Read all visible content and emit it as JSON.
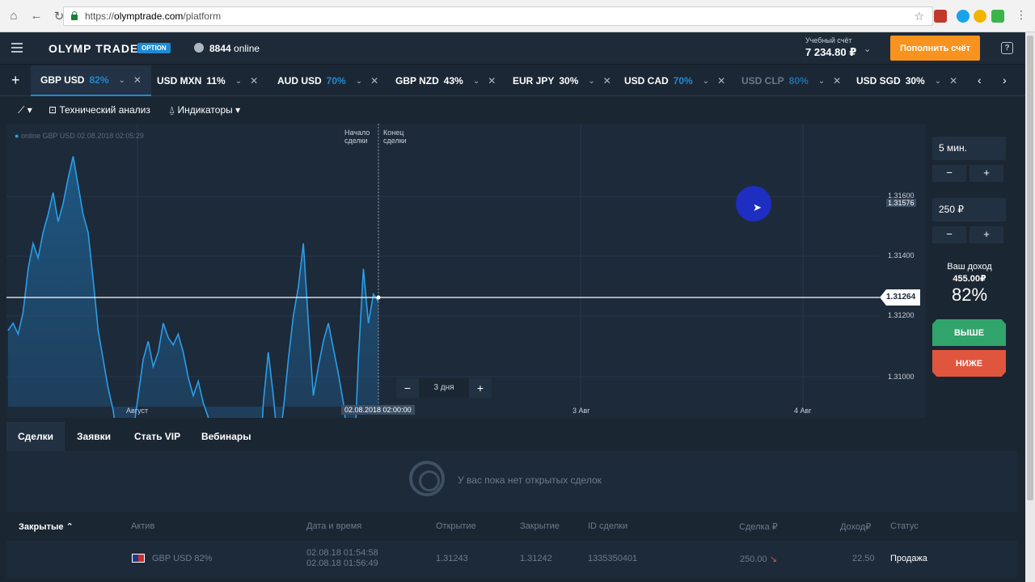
{
  "browser": {
    "url_scheme": "https://",
    "url_host": "olymptrade.com",
    "url_path": "/platform"
  },
  "header": {
    "logo": "OLYMP TRADE",
    "badge": "OPTION",
    "online_count": "8844",
    "online_label": "online",
    "account_label": "Учебный счёт",
    "account_value": "7 234.80 ₽",
    "deposit_label": "Пополнить счёт",
    "help": "?"
  },
  "tabs": [
    {
      "asset": "GBP USD",
      "pct": "82%"
    },
    {
      "asset": "USD MXN",
      "pct": "11%"
    },
    {
      "asset": "AUD USD",
      "pct": "70%"
    },
    {
      "asset": "GBP NZD",
      "pct": "43%"
    },
    {
      "asset": "EUR JPY",
      "pct": "30%"
    },
    {
      "asset": "USD CAD",
      "pct": "70%"
    },
    {
      "asset": "USD CLP",
      "pct": "80%"
    },
    {
      "asset": "USD SGD",
      "pct": "30%"
    }
  ],
  "toolbar": {
    "tech_analysis": "Технический анализ",
    "indicators": "Индикаторы"
  },
  "chart": {
    "legend": "online GBP USD  02.08.2018 02:05:29",
    "deal_start": [
      "Начало",
      "сделки"
    ],
    "deal_end": [
      "Конец",
      "сделки"
    ],
    "current_price": "1.31264",
    "marker_price": "1.31576",
    "y_ticks": [
      "1.31600",
      "1.31400",
      "1.31200",
      "1.31000"
    ],
    "x_labels": [
      "Август",
      "02.08.2018 02:00:00",
      "3 Авг",
      "4 Авг"
    ],
    "zoom_label": "3 дня",
    "zoom_minus": "−",
    "zoom_plus": "+"
  },
  "chart_data": {
    "type": "area",
    "title": "",
    "series": [
      {
        "values": [
          1.3118,
          1.312,
          1.3117,
          1.3123,
          1.3135,
          1.3142,
          1.3138,
          1.3145,
          1.315,
          1.3156,
          1.3148,
          1.3153,
          1.316,
          1.3166,
          1.3158,
          1.315,
          1.3145,
          1.3132,
          1.3118,
          1.311,
          1.3102,
          1.3096,
          1.3085,
          1.3075,
          1.3081,
          1.309,
          1.31,
          1.311,
          1.3115,
          1.3108,
          1.3112,
          1.312,
          1.3116,
          1.3114,
          1.3117,
          1.3112,
          1.3105,
          1.31,
          1.3104,
          1.3098,
          1.3094,
          1.309,
          1.3085,
          1.308,
          1.3076,
          1.3068,
          1.306,
          1.3055,
          1.305,
          1.3047,
          1.307,
          1.3098,
          1.3112,
          1.31,
          1.3085,
          1.3096,
          1.311,
          1.3122,
          1.313,
          1.3142,
          1.312,
          1.31,
          1.3108,
          1.3115,
          1.312,
          1.3113,
          1.3106,
          1.3098,
          1.3086,
          1.3077,
          1.311,
          1.3135,
          1.312,
          1.3128,
          1.3126
        ]
      }
    ],
    "ylim": [
      1.3097,
      1.3175
    ]
  },
  "side": {
    "time_value": "5 мин.",
    "amount_value": "250 ₽",
    "minus": "−",
    "plus": "+",
    "income_label": "Ваш доход",
    "income_value": "455.00₽",
    "income_pct": "82%",
    "up": "ВЫШЕ",
    "down": "НИЖЕ"
  },
  "bottom": {
    "tabs": [
      "Сделки",
      "Заявки",
      "Стать VIP",
      "Вебинары"
    ],
    "empty_text": "У вас пока нет открытых сделок",
    "closed_label": "Закрытые",
    "columns": [
      "Актив",
      "Дата и время",
      "Открытие",
      "Закрытие",
      "ID сделки",
      "Сделка ₽",
      "Доход₽",
      "Статус"
    ],
    "row": {
      "asset": "GBP USD",
      "pct": "82%",
      "date1": "02.08.18 01:54:58",
      "date2": "02.08.18 01:56:49",
      "open": "1.31243",
      "close": "1.31242",
      "id": "1335350401",
      "amount": "250.00",
      "income": "22.50",
      "status": "Продажа"
    }
  }
}
